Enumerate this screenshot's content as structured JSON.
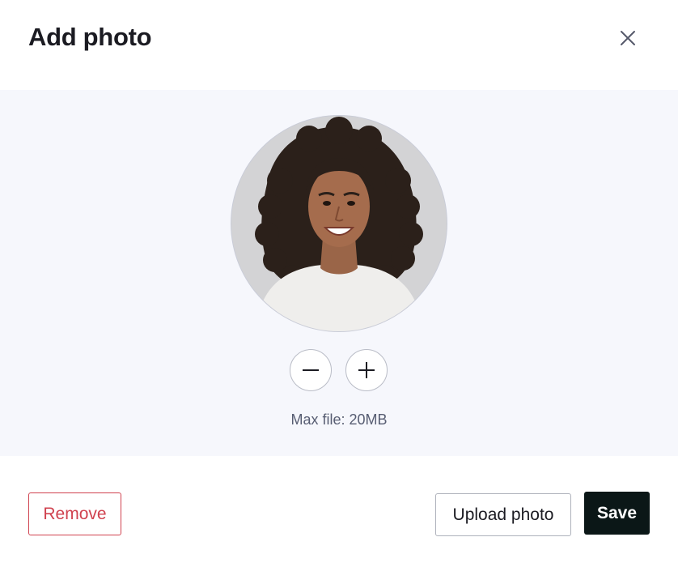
{
  "dialog": {
    "title": "Add photo"
  },
  "icons": {
    "close": "close-icon",
    "zoom_out": "minus-icon",
    "zoom_in": "plus-icon"
  },
  "photo": {
    "alt": "Profile photo preview",
    "max_file_text": "Max file: 20MB"
  },
  "actions": {
    "remove_label": "Remove",
    "upload_label": "Upload photo",
    "save_label": "Save"
  },
  "colors": {
    "danger": "#d0424f",
    "primary_button": "#0b1717",
    "preview_background": "#f6f7fc",
    "muted_text": "#575d72"
  }
}
